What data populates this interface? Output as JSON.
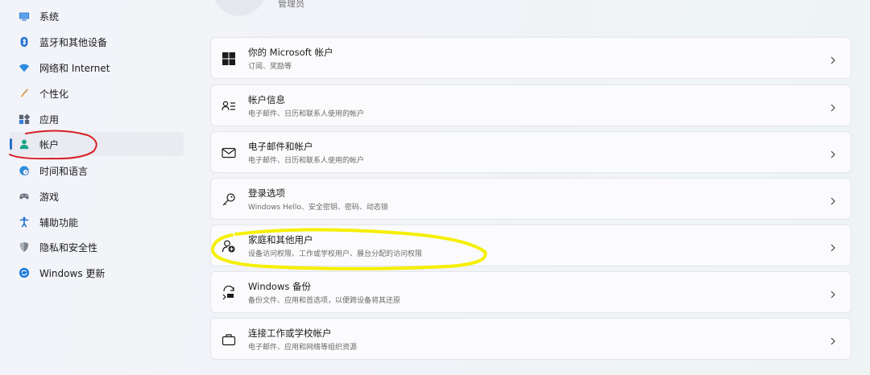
{
  "header": {
    "role": "管理员"
  },
  "sidebar": {
    "items": [
      {
        "label": "系统",
        "icon": "monitor-icon"
      },
      {
        "label": "蓝牙和其他设备",
        "icon": "bluetooth-icon"
      },
      {
        "label": "网络和 Internet",
        "icon": "wifi-icon"
      },
      {
        "label": "个性化",
        "icon": "brush-icon"
      },
      {
        "label": "应用",
        "icon": "apps-icon"
      },
      {
        "label": "帐户",
        "icon": "person-icon",
        "active": true
      },
      {
        "label": "时间和语言",
        "icon": "globe-clock-icon"
      },
      {
        "label": "游戏",
        "icon": "gamepad-icon"
      },
      {
        "label": "辅助功能",
        "icon": "accessibility-icon"
      },
      {
        "label": "隐私和安全性",
        "icon": "shield-icon"
      },
      {
        "label": "Windows 更新",
        "icon": "update-icon"
      }
    ]
  },
  "main": {
    "cards": [
      {
        "title": "你的 Microsoft 帐户",
        "subtitle": "订阅、奖励等",
        "icon": "windows-logo-icon"
      },
      {
        "title": "帐户信息",
        "subtitle": "电子邮件、日历和联系人使用的帐户",
        "icon": "account-info-icon"
      },
      {
        "title": "电子邮件和帐户",
        "subtitle": "电子邮件、日历和联系人使用的帐户",
        "icon": "mail-icon"
      },
      {
        "title": "登录选项",
        "subtitle": "Windows Hello、安全密钥、密码、动态锁",
        "icon": "key-icon"
      },
      {
        "title": "家庭和其他用户",
        "subtitle": "设备访问权限、工作或学校用户、展台分配的访问权限",
        "icon": "family-add-icon"
      },
      {
        "title": "Windows 备份",
        "subtitle": "备份文件、应用和首选项，以便跨设备将其还原",
        "icon": "backup-icon"
      },
      {
        "title": "连接工作或学校帐户",
        "subtitle": "电子邮件、应用和网络等组织资源",
        "icon": "briefcase-icon"
      }
    ]
  },
  "colors": {
    "accent": "#2a6fc7",
    "annotation_red": "#d61f26",
    "annotation_yellow": "#f5ef00"
  }
}
